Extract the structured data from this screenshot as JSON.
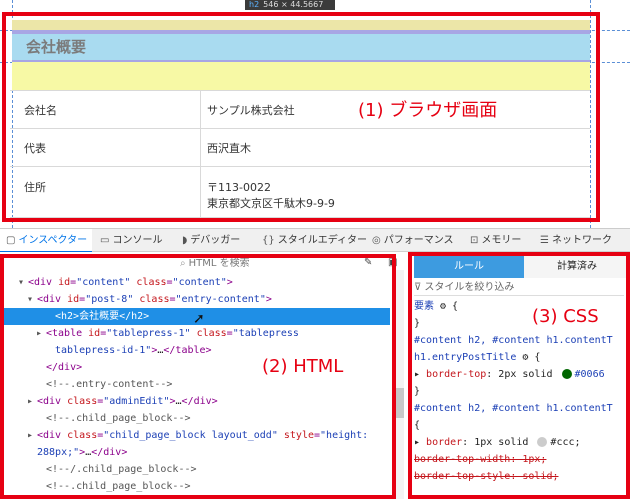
{
  "browser": {
    "tooltip_tag": "h2",
    "tooltip_size": "546 × 44.5667",
    "heading": "会社概要",
    "rows": [
      {
        "label": "会社名",
        "value": "サンプル株式会社",
        "value2": ""
      },
      {
        "label": "代表",
        "value": "西沢直木",
        "value2": ""
      },
      {
        "label": "住所",
        "value": "〒113-0022",
        "value2": "東京都文京区千駄木9-9-9"
      }
    ]
  },
  "callouts": {
    "browser": "(1) ブラウザ画面",
    "html": "(2) HTML",
    "css": "(3) CSS"
  },
  "toolbar": {
    "items": [
      {
        "icon": "inspector-icon",
        "glyph": "▢",
        "label": "インスペクター"
      },
      {
        "icon": "console-icon",
        "glyph": "▭",
        "label": "コンソール"
      },
      {
        "icon": "debugger-icon",
        "glyph": "◗",
        "label": "デバッガー"
      },
      {
        "icon": "style-editor-icon",
        "glyph": "{}",
        "label": "スタイルエディター"
      },
      {
        "icon": "performance-icon",
        "glyph": "◎",
        "label": "パフォーマンス"
      },
      {
        "icon": "memory-icon",
        "glyph": "⊡",
        "label": "メモリー"
      },
      {
        "icon": "network-icon",
        "glyph": "☰",
        "label": "ネットワーク"
      }
    ]
  },
  "html_panel": {
    "search_placeholder": "HTML を検索",
    "lines": [
      {
        "ind": 2,
        "tri": "▾",
        "parts": [
          [
            "tg",
            "<div "
          ],
          [
            "at",
            "id"
          ],
          [
            "tg",
            "="
          ],
          [
            "av",
            "\"content\""
          ],
          [
            "tg",
            " "
          ],
          [
            "at",
            "class"
          ],
          [
            "tg",
            "="
          ],
          [
            "av",
            "\"content\""
          ],
          [
            "tg",
            ">"
          ]
        ]
      },
      {
        "ind": 3,
        "tri": "▾",
        "parts": [
          [
            "tg",
            "<div "
          ],
          [
            "at",
            "id"
          ],
          [
            "tg",
            "="
          ],
          [
            "av",
            "\"post-8\""
          ],
          [
            "tg",
            " "
          ],
          [
            "at",
            "class"
          ],
          [
            "tg",
            "="
          ],
          [
            "av",
            "\"entry-content\""
          ],
          [
            "tg",
            ">"
          ]
        ]
      },
      {
        "ind": 5,
        "tri": "",
        "parts": [
          [
            "tg",
            "<h2>"
          ],
          [
            "tx",
            "会社概要"
          ],
          [
            "tg",
            "</h2>"
          ]
        ],
        "selected": true
      },
      {
        "ind": 4,
        "tri": "▸",
        "parts": [
          [
            "tg",
            "<table "
          ],
          [
            "at",
            "id"
          ],
          [
            "tg",
            "="
          ],
          [
            "av",
            "\"tablepress-1\""
          ],
          [
            "tg",
            " "
          ],
          [
            "at",
            "class"
          ],
          [
            "tg",
            "="
          ],
          [
            "av",
            "\"tablepress"
          ]
        ]
      },
      {
        "ind": 5,
        "tri": "",
        "parts": [
          [
            "av",
            "tablepress-id-1\""
          ],
          [
            "tg",
            ">"
          ],
          [
            "tx",
            "…"
          ],
          [
            "tg",
            "</table>"
          ]
        ]
      },
      {
        "ind": 4,
        "tri": "",
        "parts": [
          [
            "tg",
            "</div>"
          ]
        ]
      },
      {
        "ind": 4,
        "tri": "",
        "parts": [
          [
            "cm",
            "<!--.entry-content-->"
          ]
        ]
      },
      {
        "ind": 3,
        "tri": "▸",
        "parts": [
          [
            "tg",
            "<div "
          ],
          [
            "at",
            "class"
          ],
          [
            "tg",
            "="
          ],
          [
            "av",
            "\"adminEdit\""
          ],
          [
            "tg",
            ">"
          ],
          [
            "tx",
            "…"
          ],
          [
            "tg",
            "</div>"
          ]
        ]
      },
      {
        "ind": 4,
        "tri": "",
        "parts": [
          [
            "cm",
            "<!--.child_page_block-->"
          ]
        ]
      },
      {
        "ind": 3,
        "tri": "▸",
        "parts": [
          [
            "tg",
            "<div "
          ],
          [
            "at",
            "class"
          ],
          [
            "tg",
            "="
          ],
          [
            "av",
            "\"child_page_block layout_odd\""
          ],
          [
            "tg",
            " "
          ],
          [
            "at",
            "style"
          ],
          [
            "tg",
            "="
          ],
          [
            "av",
            "\"height:"
          ]
        ]
      },
      {
        "ind": 3,
        "tri": "",
        "parts": [
          [
            "av",
            "288px;\""
          ],
          [
            "tg",
            ">"
          ],
          [
            "tx",
            "…"
          ],
          [
            "tg",
            "</div>"
          ]
        ]
      },
      {
        "ind": 4,
        "tri": "",
        "parts": [
          [
            "cm",
            "<!--/.child_page_block-->"
          ]
        ]
      },
      {
        "ind": 4,
        "tri": "",
        "parts": [
          [
            "cm",
            "<!--.child_page_block-->"
          ]
        ]
      }
    ]
  },
  "css_panel": {
    "tab_rules": "ルール",
    "tab_computed": "計算済み",
    "filter_placeholder": "スタイルを絞り込み",
    "lines": [
      {
        "parts": [
          [
            "sel",
            "要素"
          ],
          [
            "tx",
            " ⚙ {"
          ]
        ]
      },
      {
        "parts": [
          [
            "tx",
            "}"
          ]
        ]
      },
      {
        "parts": [
          [
            "sel",
            "#content h2, #content h1.contentT"
          ]
        ]
      },
      {
        "parts": [
          [
            "sel",
            "h1.entryPostTitle"
          ],
          [
            "tx",
            " ⚙ {"
          ]
        ]
      },
      {
        "parts": [
          [
            "tx",
            "  ▸ "
          ],
          [
            "prop",
            "border-top"
          ],
          [
            "tx",
            ": 2px solid "
          ],
          [
            "sw",
            "#006600"
          ],
          [
            "av",
            "#0066"
          ]
        ]
      },
      {
        "parts": [
          [
            "tx",
            "}"
          ]
        ]
      },
      {
        "parts": [
          [
            "sel",
            "#content h2, #content h1.contentT"
          ]
        ]
      },
      {
        "parts": [
          [
            "tx",
            "{"
          ]
        ]
      },
      {
        "parts": [
          [
            "tx",
            "  ▸ "
          ],
          [
            "prop",
            "border"
          ],
          [
            "tx",
            ": 1px solid "
          ],
          [
            "sw",
            "#cccccc"
          ],
          [
            "tx",
            "#ccc;"
          ]
        ]
      },
      {
        "parts": [
          [
            "st",
            "    border-top-width: 1px;"
          ]
        ]
      },
      {
        "parts": [
          [
            "st",
            "    border-top-style: solid;"
          ]
        ]
      }
    ]
  },
  "colors": {
    "callout": "#e60012",
    "accent": "#0074e8",
    "selected_row": "#1f8fe6"
  }
}
